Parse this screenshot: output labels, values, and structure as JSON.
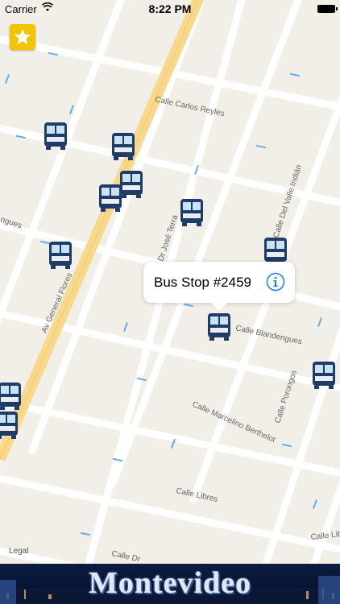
{
  "status_bar": {
    "carrier": "Carrier",
    "time": "8:22 PM"
  },
  "map": {
    "streets": [
      {
        "name": "Calle Carlos Reyles"
      },
      {
        "name": "Calle Del Valle Indián"
      },
      {
        "name": "Dr José Terra"
      },
      {
        "name": "Av General Flores"
      },
      {
        "name": "Calle Blandengues"
      },
      {
        "name": "Calle Porongos"
      },
      {
        "name": "Calle Marcelino Berthelot"
      },
      {
        "name": "Calle Libres"
      },
      {
        "name": "Calle Dr"
      },
      {
        "name": "Calle Lib"
      },
      {
        "name": "ngues"
      }
    ],
    "bus_stops_count": 11,
    "legal": "Legal"
  },
  "callout": {
    "title": "Bus Stop #2459",
    "accent": "#1a7ef2"
  },
  "favorites": {
    "icon": "star-icon",
    "color": "#f4c400"
  },
  "banner": {
    "title": "Montevideo"
  },
  "colors": {
    "map_bg": "#f2efe9",
    "road": "#ffffff",
    "avenue": "#f8d88a",
    "bus_icon": "#1f3c68"
  }
}
